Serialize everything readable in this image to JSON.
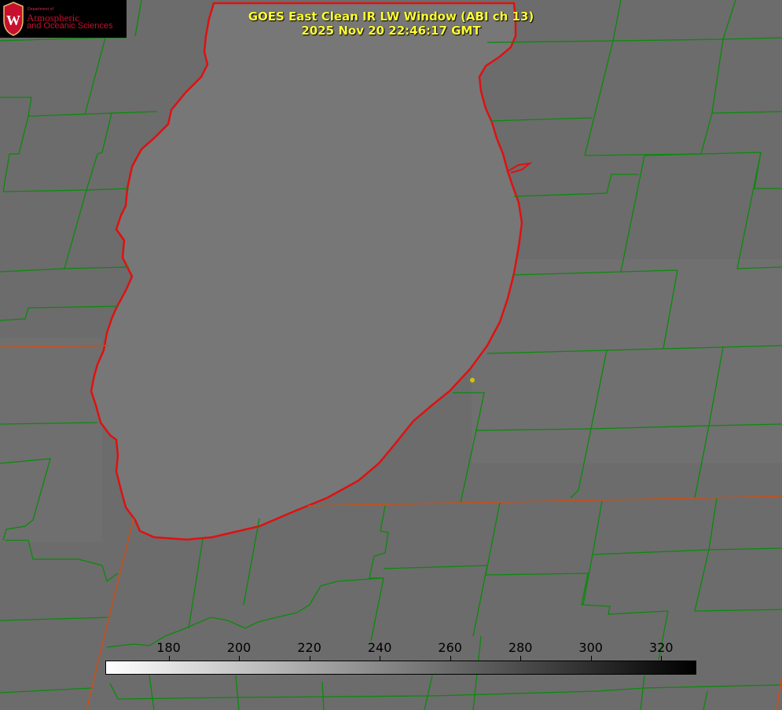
{
  "title": {
    "line1": "GOES East Clean IR LW Window (ABI ch 13)",
    "line2": "2025 Nov 20 22:46:17 GMT"
  },
  "logo": {
    "department": "Department of",
    "line1": "Atmospheric",
    "line2": "and Oceanic Sciences",
    "seal_letter": "W",
    "color": "#c8102e"
  },
  "colorbar": {
    "ticks": [
      "180",
      "200",
      "220",
      "240",
      "260",
      "280",
      "300",
      "320"
    ],
    "tick_values": [
      180,
      200,
      220,
      240,
      260,
      280,
      300,
      320
    ],
    "range": [
      162,
      330
    ],
    "gradient_from": "#ffffff",
    "gradient_to": "#000000"
  },
  "colors": {
    "background": "#6c6c6c",
    "lake": "#777777",
    "county_lines": "#0a8a0a",
    "state_lines": "#c8501a",
    "lake_outline": "#e01010",
    "marker": "#d4c400",
    "title": "#ffff33"
  }
}
